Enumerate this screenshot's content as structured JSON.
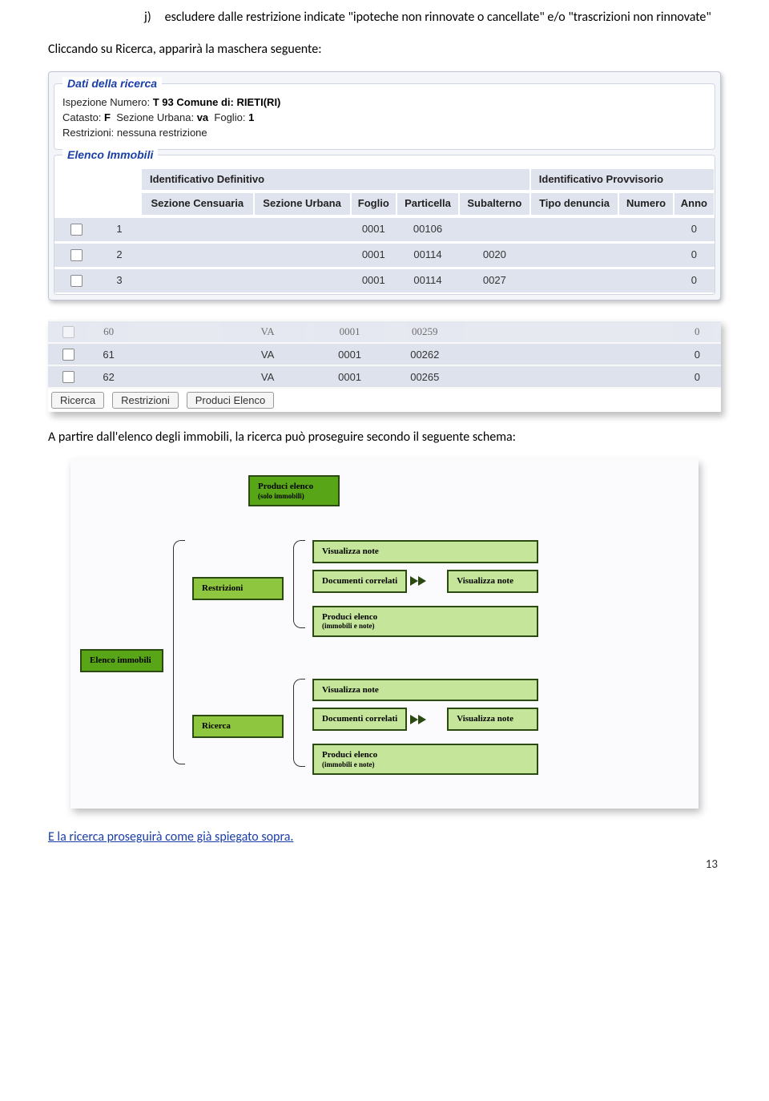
{
  "intro": {
    "j_label": "j)",
    "j_text": "escludere dalle restrizione indicate \"ipoteche non rinnovate o cancellate\" e/o \"trascrizioni non rinnovate\"",
    "click_text": "Cliccando su Ricerca, apparirà la maschera seguente:"
  },
  "shot1": {
    "legend1": "Dati della ricerca",
    "l1a": "Ispezione Numero:",
    "l1a_val": "T 93 Comune di:",
    "l1a_val2": "RIETI(RI)",
    "l1b": "Catasto:",
    "l1b_val": "F",
    "l1c": "Sezione Urbana:",
    "l1c_val": "va",
    "l1d": "Foglio:",
    "l1d_val": "1",
    "l1e": "Restrizioni: nessuna restrizione",
    "legend2": "Elenco Immobili",
    "group1": "Identificativo Definitivo",
    "group2": "Identificativo Provvisorio",
    "h_sc": "Sezione Censuaria",
    "h_su": "Sezione Urbana",
    "h_fo": "Foglio",
    "h_pa": "Particella",
    "h_sb": "Subalterno",
    "h_td": "Tipo denuncia",
    "h_nu": "Numero",
    "h_an": "Anno",
    "rows": [
      {
        "n": "1",
        "su": "",
        "fo": "0001",
        "pa": "00106",
        "sb": "",
        "an": "0"
      },
      {
        "n": "2",
        "su": "",
        "fo": "0001",
        "pa": "00114",
        "sb": "0020",
        "an": "0"
      },
      {
        "n": "3",
        "su": "",
        "fo": "0001",
        "pa": "00114",
        "sb": "0027",
        "an": "0"
      }
    ]
  },
  "shot2": {
    "rows": [
      {
        "n": "60",
        "su": "VA",
        "fo": "0001",
        "pa": "00259",
        "an": "0"
      },
      {
        "n": "61",
        "su": "VA",
        "fo": "0001",
        "pa": "00262",
        "an": "0"
      },
      {
        "n": "62",
        "su": "VA",
        "fo": "0001",
        "pa": "00265",
        "an": "0"
      }
    ],
    "btn1": "Ricerca",
    "btn2": "Restrizioni",
    "btn3": "Produci Elenco"
  },
  "after": "A partire dall'elenco degli immobili, la ricerca può proseguire secondo il seguente schema:",
  "diagram": {
    "elenco": "Elenco immobili",
    "produci_solo": "Produci elenco",
    "produci_solo_sub": "(solo immobili)",
    "restrizioni": "Restrizioni",
    "visualizza": "Visualizza note",
    "documenti": "Documenti correlati",
    "produci_note": "Produci elenco",
    "produci_note_sub": "(immobili e note)",
    "ricerca": "Ricerca"
  },
  "final": "E la ricerca proseguirà come già spiegato sopra.",
  "page_num": "13"
}
